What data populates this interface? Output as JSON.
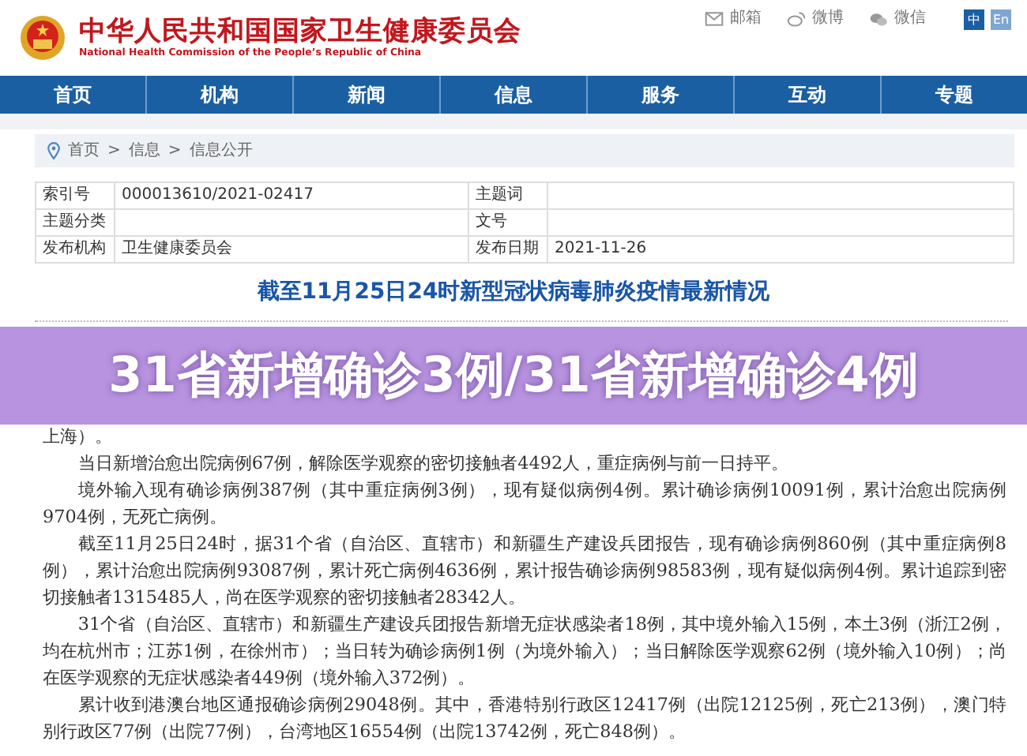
{
  "header": {
    "title": "中华人民共和国国家卫生健康委员会",
    "subtitle": "National Health Commission of the People’s Republic of China",
    "links": [
      {
        "kind": "mail",
        "label": "邮箱"
      },
      {
        "kind": "weibo",
        "label": "微博"
      },
      {
        "kind": "wechat",
        "label": "微信"
      }
    ],
    "languages": [
      {
        "label": "中",
        "selected": true
      },
      {
        "label": "En",
        "selected": false
      }
    ]
  },
  "nav": [
    {
      "label": "首页"
    },
    {
      "label": "机构"
    },
    {
      "label": "新闻"
    },
    {
      "label": "信息"
    },
    {
      "label": "服务"
    },
    {
      "label": "互动"
    },
    {
      "label": "专题"
    }
  ],
  "breadcrumb": {
    "separator": ">",
    "items": [
      "首页",
      "信息",
      "信息公开"
    ]
  },
  "meta_table": [
    [
      {
        "label": "索引号",
        "value": "000013610/2021-02417"
      },
      {
        "label": "主题词"
      }
    ],
    [
      {
        "label": "主题分类"
      },
      {
        "label": "文号"
      }
    ],
    [
      {
        "label": "发布机构",
        "value": "卫生健康委员会"
      },
      {
        "label": "发布日期",
        "value": "2021-11-26"
      }
    ]
  ],
  "article": {
    "title": "截至11月25日24时新型冠状病毒肺炎疫情最新情况",
    "banner": "31省新增确诊3例/31省新增确诊4例",
    "fragment": "上海）。",
    "paragraphs": [
      "当日新增治愈出院病例67例，解除医学观察的密切接触者4492人，重症病例与前一日持平。",
      "境外输入现有确诊病例387例（其中重症病例3例），现有疑似病例4例。累计确诊病例10091例，累计治愈出院病例9704例，无死亡病例。",
      "截至11月25日24时，据31个省（自治区、直辖市）和新疆生产建设兵团报告，现有确诊病例860例（其中重症病例8例），累计治愈出院病例93087例，累计死亡病例4636例，累计报告确诊病例98583例，现有疑似病例4例。累计追踪到密切接触者1315485人，尚在医学观察的密切接触者28342人。",
      "31个省（自治区、直辖市）和新疆生产建设兵团报告新增无症状感染者18例，其中境外输入15例，本土3例（浙江2例，均在杭州市；江苏1例，在徐州市）；当日转为确诊病例1例（为境外输入）；当日解除医学观察62例（境外输入10例）；尚在医学观察的无症状感染者449例（境外输入372例）。",
      "累计收到港澳台地区通报确诊病例29048例。其中，香港特别行政区12417例（出院12125例，死亡213例），澳门特别行政区77例（出院77例），台湾地区16554例（出院13742例，死亡848例）。"
    ]
  }
}
